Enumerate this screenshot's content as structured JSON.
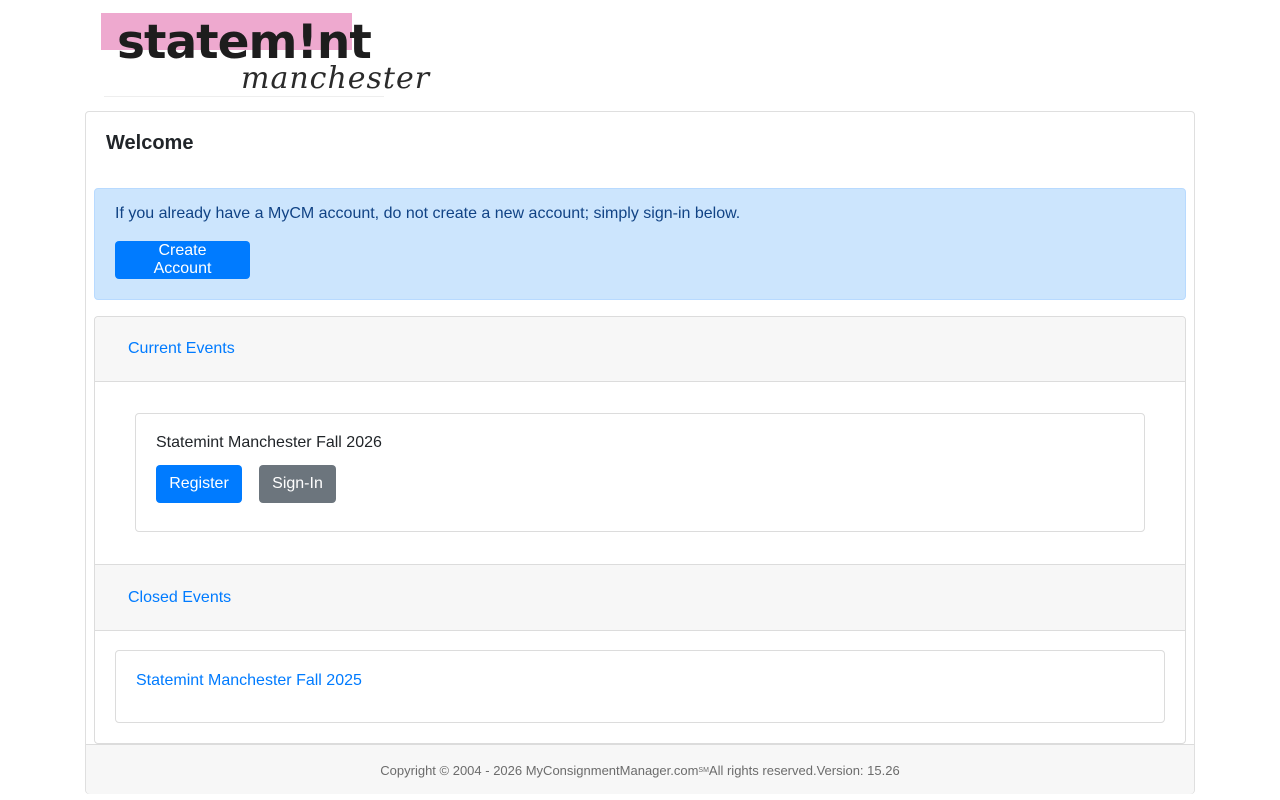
{
  "logo": {
    "wordmark": "statem!nt",
    "script": "manchester",
    "colors": {
      "pink_band": "#eea9cf",
      "text": "#1d1d1d"
    }
  },
  "welcome": {
    "title": "Welcome"
  },
  "alert": {
    "message": "If you already have a MyCM account, do not create a new account; simply sign-in below.",
    "create_account_label": "Create Account"
  },
  "current_events": {
    "header": "Current Events",
    "events": [
      {
        "title": "Statemint Manchester Fall 2026",
        "register_label": "Register",
        "signin_label": "Sign-In"
      }
    ]
  },
  "closed_events": {
    "header": "Closed Events",
    "events": [
      {
        "title": "Statemint Manchester Fall 2025"
      }
    ]
  },
  "footer": {
    "prefix": "Copyright © 2004 - 2026 MyConsignmentManager.com",
    "mark": "SM",
    "suffix": " All rights reserved.Version: 15.26"
  },
  "colors": {
    "primary": "#007bff",
    "secondary": "#6c757d",
    "alert_bg": "#cce5fd",
    "alert_text": "#114385",
    "panel_header": "#f7f7f7"
  }
}
